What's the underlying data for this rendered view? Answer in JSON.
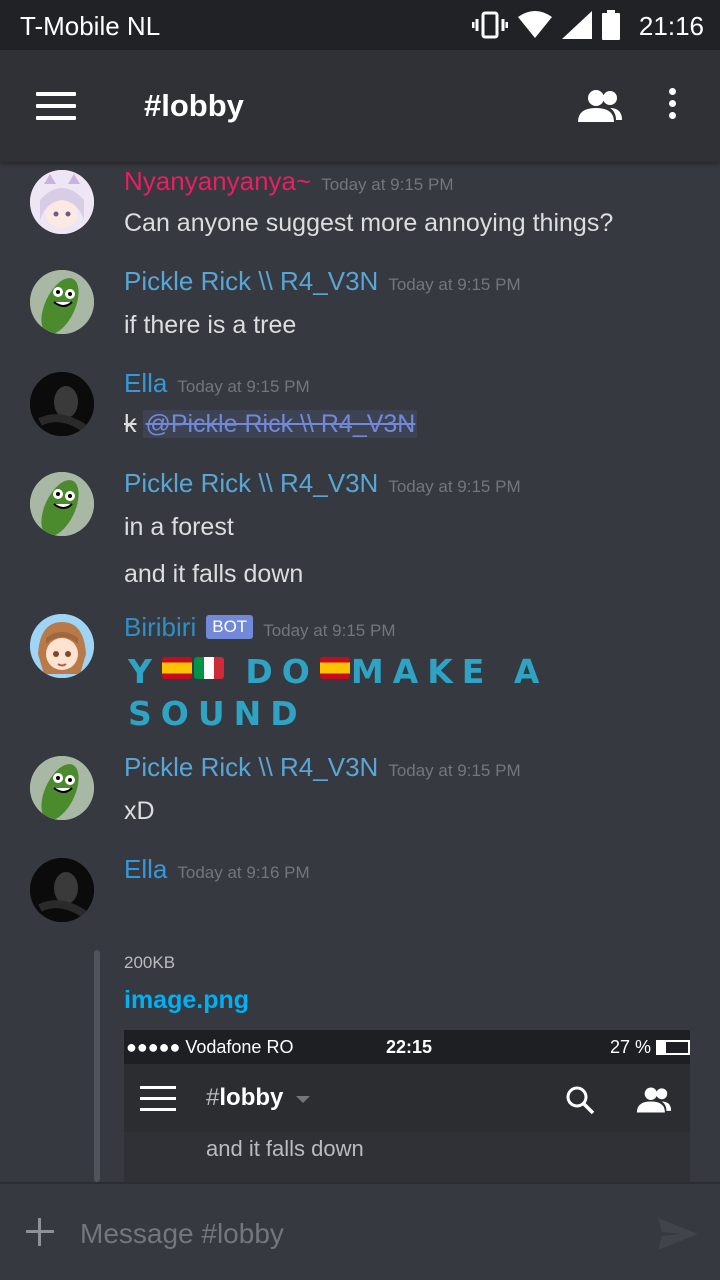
{
  "status_bar": {
    "carrier": "T-Mobile  NL",
    "time": "21:16"
  },
  "channel": {
    "title": "#lobby"
  },
  "colors": {
    "pink_author": "#e91e63",
    "blue_author": "#58a6d6",
    "bot_author": "#3498db",
    "mention": "#7289da",
    "link": "#00b0f4",
    "bigtext": "#2fa3c3"
  },
  "messages": [
    {
      "author": "Nyanyanyanya~",
      "timestamp": "Today at 9:15 PM",
      "lines": [
        "Can anyone suggest more annoying things?"
      ]
    },
    {
      "author": "Pickle Rick \\\\ R4_V3N",
      "timestamp": "Today at 9:15 PM",
      "lines": [
        "if there is a tree"
      ]
    },
    {
      "author": "Ella",
      "timestamp": "Today at 9:15 PM",
      "text_prefix": "k",
      "mention": "@Pickle Rick \\\\ R4_V3N"
    },
    {
      "author": "Pickle Rick \\\\ R4_V3N",
      "timestamp": "Today at 9:15 PM",
      "lines": [
        "in a forest",
        "and it falls down"
      ]
    },
    {
      "author": "Biribiri",
      "badge": "BOT",
      "timestamp": "Today at 9:15 PM",
      "big_text": {
        "a": "Y",
        "b": "DO",
        "c": "MAKE A",
        "d": "SOUND"
      }
    },
    {
      "author": "Pickle Rick \\\\ R4_V3N",
      "timestamp": "Today at 9:15 PM",
      "lines": [
        "xD"
      ]
    },
    {
      "author": "Ella",
      "timestamp": "Today at 9:16 PM",
      "attachment": {
        "size": "200KB",
        "filename": "image.png",
        "preview": {
          "carrier": "●●●●● Vodafone RO",
          "time": "22:15",
          "battery": "27 %",
          "hash": "#",
          "channel": "lobby",
          "text": "and it falls down"
        }
      }
    }
  ],
  "composer": {
    "placeholder": "Message #lobby"
  }
}
